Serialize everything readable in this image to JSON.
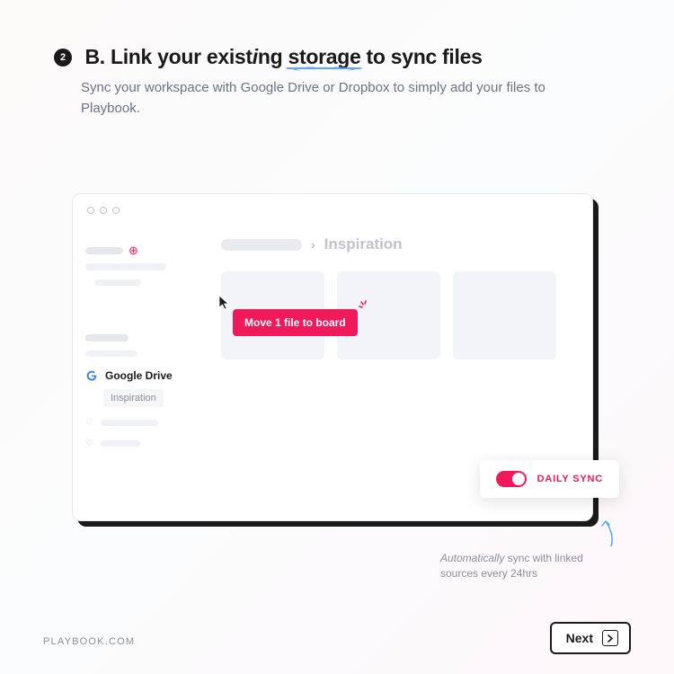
{
  "step": {
    "number": "2",
    "prefix": "B. Link your exist",
    "italic": "i",
    "mid": "ng ",
    "underlined": "storage",
    "suffix": " to sync files",
    "subtitle": "Sync your workspace with Google Drive or Dropbox to simply add your files to Playbook."
  },
  "sidebar": {
    "google_drive_label": "Google Drive",
    "inspiration_label": "Inspiration"
  },
  "breadcrumb": {
    "current": "Inspiration"
  },
  "drag_badge": {
    "label": "Move 1 file to board"
  },
  "sync": {
    "toggle_label": "DAILY SYNC",
    "helper_italic": "Automatically",
    "helper_rest": " sync with linked sources every 24hrs"
  },
  "footer": {
    "brand": "PLAYBOOK.COM",
    "next_label": "Next"
  }
}
